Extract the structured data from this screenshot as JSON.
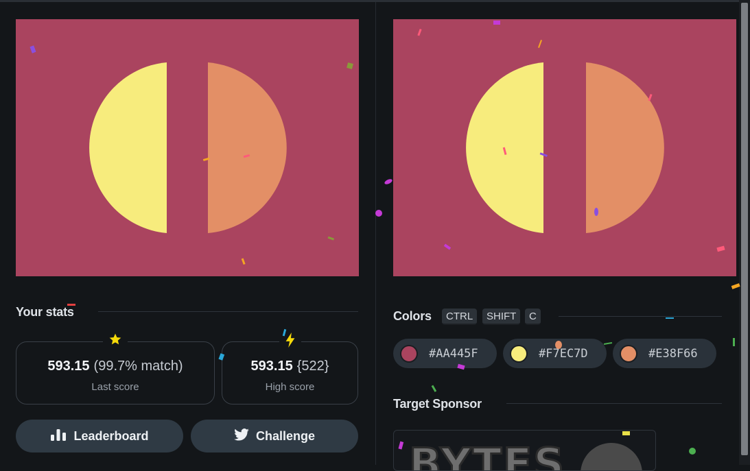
{
  "colors": {
    "background": "#AA445F",
    "left_shape": "#F7EC7D",
    "right_shape": "#E38F66"
  },
  "stats": {
    "title": "Your stats",
    "last": {
      "icon": "star-icon",
      "score": "593.15",
      "match": "(99.7% match)",
      "label": "Last score"
    },
    "high": {
      "icon": "lightning-icon",
      "score": "593.15",
      "rank": "{522}",
      "label": "High score"
    }
  },
  "buttons": {
    "leaderboard": {
      "icon": "bar-chart-icon",
      "label": "Leaderboard"
    },
    "challenge": {
      "icon": "twitter-icon",
      "label": "Challenge"
    }
  },
  "colors_panel": {
    "title": "Colors",
    "shortcut": [
      "CTRL",
      "SHIFT",
      "C"
    ],
    "chips": [
      "#AA445F",
      "#F7EC7D",
      "#E38F66"
    ]
  },
  "sponsor": {
    "title": "Target Sponsor",
    "logo_text": "BYTES"
  }
}
